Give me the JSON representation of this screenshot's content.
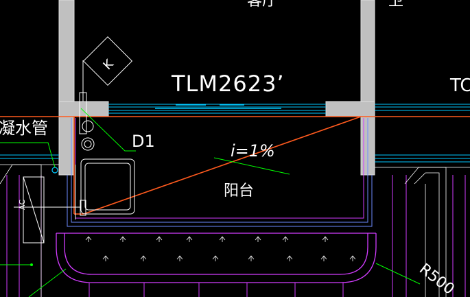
{
  "drawing": {
    "room_label_top_left": "客厅",
    "room_label_top_right": "卫",
    "door_label_center": "TLM2623’",
    "door_label_right": "TC",
    "drain_tag": "D1",
    "slope_label": "i=1%",
    "balcony_label": "阳台",
    "pipe_label": "凝水管",
    "radius_label": "R500",
    "ac_unit_label": "K",
    "side_unit_label": "AC"
  },
  "colors": {
    "background": "#000000",
    "wall": "#c0c0c0",
    "slope_line": "#ff5a1e",
    "leader": "#00ff00",
    "window": "#00c8ff",
    "magenta": "#d23cff",
    "blue": "#6e8cff",
    "white": "#ffffff"
  }
}
